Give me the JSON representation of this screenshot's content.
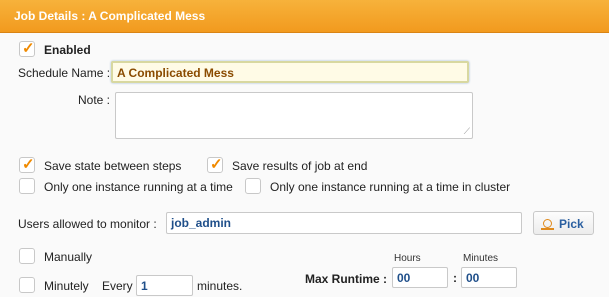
{
  "header": {
    "title": "Job Details : A Complicated Mess"
  },
  "enabled": {
    "label": "Enabled",
    "checked": true
  },
  "schedule_name": {
    "label": "Schedule Name :",
    "value": "A Complicated Mess"
  },
  "note": {
    "label": "Note :",
    "value": ""
  },
  "options": {
    "save_state": {
      "label": "Save state between steps",
      "checked": true
    },
    "save_results": {
      "label": "Save results of job at end",
      "checked": true
    },
    "one_instance": {
      "label": "Only one instance running at a time",
      "checked": false
    },
    "one_instance_cluster": {
      "label": "Only one instance running at a time in cluster",
      "checked": false
    }
  },
  "users": {
    "label": "Users allowed to monitor :",
    "value": "job_admin",
    "pick_label": "Pick"
  },
  "manually": {
    "label": "Manually",
    "checked": false
  },
  "minutely": {
    "label": "Minutely",
    "checked": false,
    "every_label": "Every",
    "every_value": "1",
    "unit_label": "minutes."
  },
  "max_runtime": {
    "label": "Max Runtime :",
    "hours_header": "Hours",
    "minutes_header": "Minutes",
    "hours_value": "00",
    "minutes_value": "00",
    "separator": ":"
  }
}
